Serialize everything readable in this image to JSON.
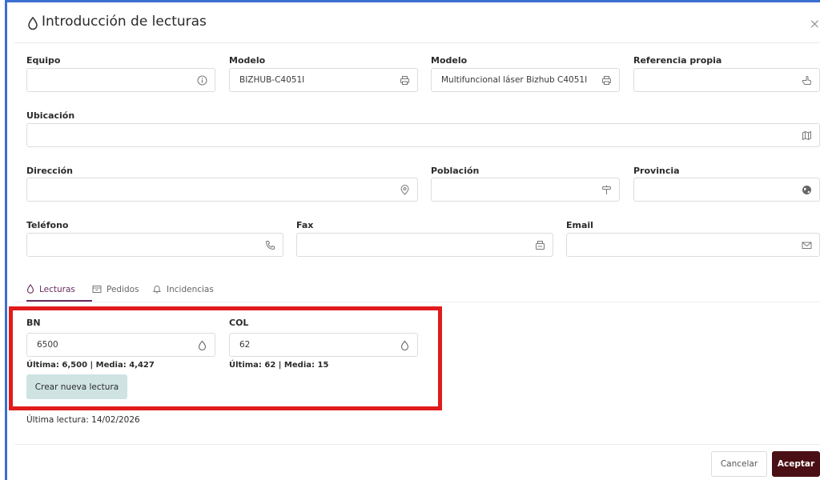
{
  "modal": {
    "title": "Introducción de lecturas",
    "close_glyph": "×"
  },
  "fields": {
    "equipo": {
      "label": "Equipo",
      "value": "",
      "icon": "info-icon"
    },
    "modelo1": {
      "label": "Modelo",
      "value": "BIZHUB-C4051I",
      "icon": "printer-icon"
    },
    "modelo2": {
      "label": "Modelo",
      "value": "Multifuncional láser Bizhub C4051I",
      "icon": "printer-icon"
    },
    "referencia": {
      "label": "Referencia propia",
      "value": "",
      "icon": "pointer-hand-icon"
    },
    "ubicacion": {
      "label": "Ubicación",
      "value": "",
      "icon": "map-icon"
    },
    "direccion": {
      "label": "Dirección",
      "value": "",
      "icon": "location-pin-icon"
    },
    "poblacion": {
      "label": "Población",
      "value": "",
      "icon": "signpost-icon"
    },
    "provincia": {
      "label": "Provincia",
      "value": "",
      "icon": "globe-icon"
    },
    "telefono": {
      "label": "Teléfono",
      "value": "",
      "icon": "phone-icon"
    },
    "fax": {
      "label": "Fax",
      "value": "",
      "icon": "fax-icon"
    },
    "email": {
      "label": "Email",
      "value": "",
      "icon": "envelope-icon"
    }
  },
  "tabs": [
    {
      "label": "Lecturas",
      "icon": "drop-icon",
      "active": true
    },
    {
      "label": "Pedidos",
      "icon": "box-icon",
      "active": false
    },
    {
      "label": "Incidencias",
      "icon": "bell-icon",
      "active": false
    }
  ],
  "readings": {
    "bn": {
      "label": "BN",
      "value": "6500",
      "stats": "Última: 6,500 | Media: 4,427",
      "icon": "drop-icon"
    },
    "col": {
      "label": "COL",
      "value": "62",
      "stats": "Última: 62 | Media: 15",
      "icon": "drop-icon"
    },
    "create_button": "Crear nueva lectura",
    "last_reading": "Última lectura: 14/02/2026"
  },
  "footer": {
    "cancel_label": "Cancelar",
    "accept_label": "Aceptar"
  },
  "colors": {
    "accent": "#6b2c5f",
    "primary_button": "#4a0f14",
    "secondary_button": "#cfe3e3",
    "highlight_box": "#e01b1b",
    "frame_line": "#3b6fd1"
  }
}
